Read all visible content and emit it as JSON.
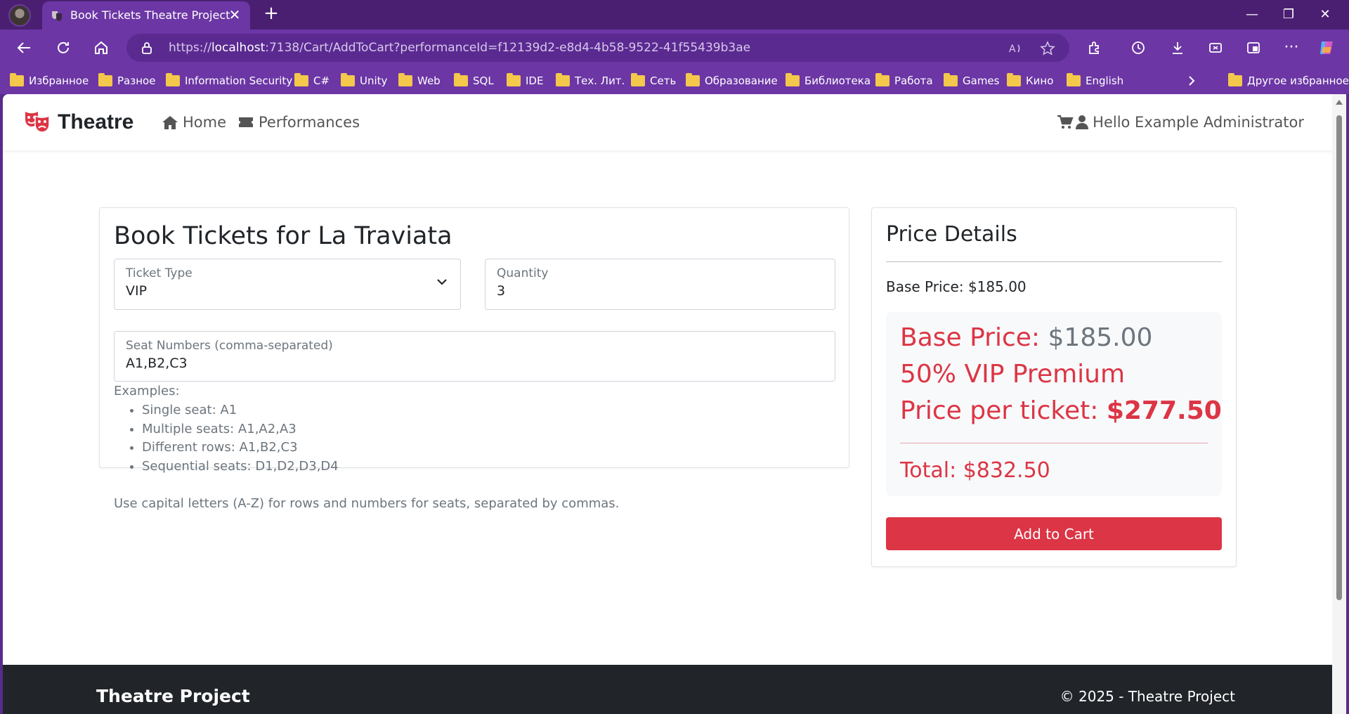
{
  "browser": {
    "tab_title": "Book Tickets Theatre Project",
    "url_prefix": "https://",
    "url_host": "localhost",
    "url_rest": ":7138/Cart/AddToCart?performanceId=f12139d2-e8d4-4b58-9522-41f55439b3ae",
    "bookmarks": [
      "Избранное",
      "Разное",
      "Information Security",
      "C#",
      "Unity",
      "Web",
      "SQL",
      "IDE",
      "Тех. Лит.",
      "Сеть",
      "Образование",
      "Библиотека",
      "Работа",
      "Games",
      "Кино",
      "English"
    ],
    "other_bookmarks": "Другое избранное"
  },
  "nav": {
    "brand": "Theatre",
    "home": "Home",
    "performances": "Performances",
    "user": "Hello Example Administrator"
  },
  "booking": {
    "title": "Book Tickets for La Traviata",
    "ticket_type_label": "Ticket Type",
    "ticket_type_value": "VIP",
    "quantity_label": "Quantity",
    "quantity_value": "3",
    "seats_label": "Seat Numbers (comma-separated)",
    "seats_value": "A1,B2,C3",
    "examples_title": "Examples:",
    "examples": [
      "Single seat: A1",
      "Multiple seats: A1,A2,A3",
      "Different rows: A1,B2,C3",
      "Sequential seats: D1,D2,D3,D4"
    ],
    "hint": "Use capital letters (A-Z) for rows and numbers for seats, separated by commas."
  },
  "price": {
    "title": "Price Details",
    "base_line": "Base Price: $185.00",
    "box_base_label": "Base Price:",
    "box_base_value": "$185.00",
    "premium": "50% VIP Premium",
    "per_ticket_label": "Price per ticket:",
    "per_ticket_value": "$277.50",
    "total": "Total: $832.50",
    "add_button": "Add to Cart"
  },
  "footer": {
    "brand": "Theatre Project",
    "copyright": "© 2025 - Theatre Project"
  },
  "colors": {
    "accent": "#dc3545",
    "browser_frame": "#6c36a5",
    "footer_bg": "#212529"
  }
}
